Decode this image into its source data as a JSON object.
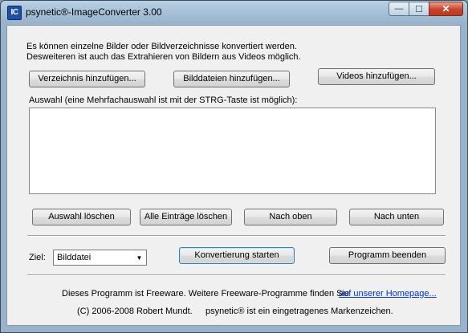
{
  "window": {
    "title": "psynetic®-ImageConverter 3.00",
    "icon_text": "IC",
    "controls": {
      "minimize": "—",
      "maximize": "☐",
      "close": "✕"
    }
  },
  "intro": {
    "line1": "Es können einzelne Bilder oder Bildverzeichnisse konvertiert werden.",
    "line2": "Desweiteren ist auch das Extrahieren von Bildern aus Videos möglich."
  },
  "add_buttons": {
    "directory": "Verzeichnis hinzufügen...",
    "images": "Bilddateien hinzufügen...",
    "videos": "Videos hinzufügen..."
  },
  "selection": {
    "label": "Auswahl (eine Mehrfachauswahl ist mit der STRG-Taste ist möglich):",
    "items": []
  },
  "list_buttons": {
    "delete_selection": "Auswahl löschen",
    "delete_all": "Alle Einträge löschen",
    "move_up": "Nach oben",
    "move_down": "Nach unten"
  },
  "target": {
    "label": "Ziel:",
    "selected": "Bilddatei"
  },
  "actions": {
    "start": "Konvertierung starten",
    "exit": "Programm beenden"
  },
  "footer": {
    "freeware_text": "Dieses Programm ist Freeware. Weitere Freeware-Programme finden Sie",
    "homepage_link": "auf unserer Homepage...",
    "copyright": "(C) 2006-2008 Robert Mundt.",
    "trademark": "psynetic® ist ein eingetragenes Markenzeichen."
  },
  "colors": {
    "link": "#0033cc",
    "close_button": "#c7432a",
    "titlebar": "#a7c1d8"
  }
}
